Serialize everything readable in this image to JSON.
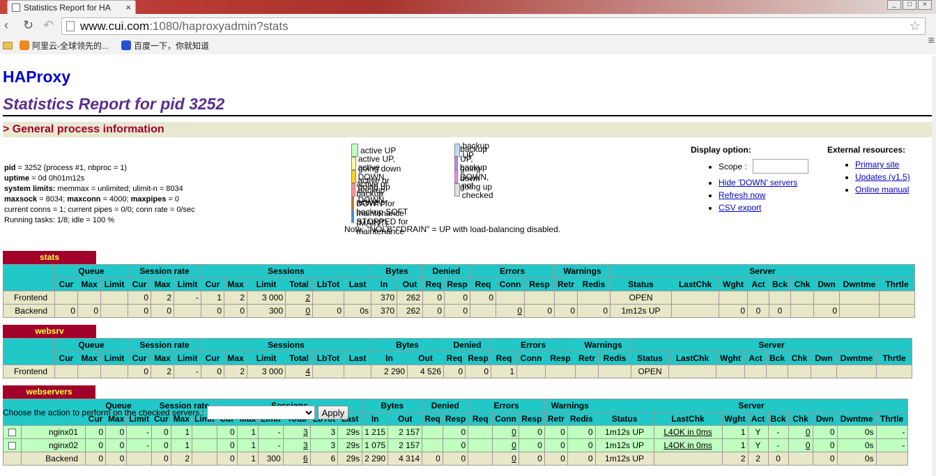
{
  "browser": {
    "tab_title": "Statistics Report for HA",
    "url_host": "www.cui.com",
    "url_rest": ":1080/haproxyadmin?stats",
    "bookmarks": [
      "阿里云-全球领先的...",
      "百度一下，你就知道"
    ]
  },
  "page": {
    "title": "HAProxy",
    "subtitle": "Statistics Report for pid 3252",
    "section": "> General process information"
  },
  "process": {
    "l1a": "pid",
    "l1b": " = 3252 (process #1, nbproc = 1)",
    "l2a": "uptime",
    "l2b": " = 0d 0h01m12s",
    "l3a": "system limits:",
    "l3b": " memmax = unlimited; ulimit-n = 8034",
    "l4a": "maxsock",
    "l4b": " = 8034; ",
    "l4c": "maxconn",
    "l4d": " = 4000; ",
    "l4e": "maxpipes",
    "l4f": " = 0",
    "l5": "current conns = 1; current pipes = 0/0; conn rate = 0/sec",
    "l6": "Running tasks: 1/8; idle = 100 %"
  },
  "legend": {
    "left": [
      {
        "label": "active UP",
        "color": "#c0ffc0"
      },
      {
        "label": "active UP, going down",
        "color": "#ffffa0"
      },
      {
        "label": "active DOWN, going up",
        "color": "#ffd020"
      },
      {
        "label": "active or backup DOWN",
        "color": "#ff9090"
      },
      {
        "label": "active or backup DOWN for maintenance (MAINT)",
        "color": "#c07820"
      },
      {
        "label": "active or backup SOFT STOPPED for maintenance",
        "color": "#3090e0"
      }
    ],
    "right": [
      {
        "label": "backup UP",
        "color": "#c0d8ff"
      },
      {
        "label": "backup UP, going down",
        "color": "#c080ff"
      },
      {
        "label": "backup DOWN, going up",
        "color": "#ff80ff"
      },
      {
        "label": "not checked",
        "color": "#e0e0e0"
      }
    ],
    "note": "Note: \"NOLB\"/\"DRAIN\" = UP with load-balancing disabled."
  },
  "display": {
    "title": "Display option:",
    "scope_label": "Scope :",
    "links": [
      "Hide 'DOWN' servers",
      "Refresh now",
      "CSV export"
    ]
  },
  "external": {
    "title": "External resources:",
    "links": [
      "Primary site",
      "Updates (v1.5)",
      "Online manual"
    ]
  },
  "headers": {
    "groups": [
      "Queue",
      "Session rate",
      "Sessions",
      "Bytes",
      "Denied",
      "Errors",
      "Warnings",
      "Server"
    ],
    "cols": [
      "Cur",
      "Max",
      "Limit",
      "Cur",
      "Max",
      "Limit",
      "Cur",
      "Max",
      "Limit",
      "Total",
      "LbTot",
      "Last",
      "In",
      "Out",
      "Req",
      "Resp",
      "Req",
      "Conn",
      "Resp",
      "Retr",
      "Redis",
      "Status",
      "LastChk",
      "Wght",
      "Act",
      "Bck",
      "Chk",
      "Dwn",
      "Dwntme",
      "Thrtle"
    ]
  },
  "proxies": [
    {
      "name": "stats",
      "checkbox": false,
      "rows": [
        {
          "cls": "fe",
          "name": "Frontend",
          "cells": [
            "",
            "",
            "",
            "0",
            "2",
            "-",
            "1",
            "2",
            "3 000",
            "2",
            "",
            "",
            "370",
            "262",
            "0",
            "0",
            "0",
            "",
            "",
            "",
            "",
            "OPEN",
            "",
            "",
            "",
            "",
            "",
            "",
            "",
            ""
          ]
        },
        {
          "cls": "be",
          "name": "Backend",
          "cells": [
            "0",
            "0",
            "",
            "0",
            "0",
            "",
            "0",
            "0",
            "300",
            "0",
            "0",
            "0s",
            "370",
            "262",
            "0",
            "0",
            "",
            "0",
            "0",
            "0",
            "0",
            "1m12s UP",
            "",
            "0",
            "0",
            "0",
            "",
            "0",
            "",
            ""
          ]
        }
      ]
    },
    {
      "name": "websrv",
      "checkbox": false,
      "rows": [
        {
          "cls": "fe",
          "name": "Frontend",
          "cells": [
            "",
            "",
            "",
            "0",
            "2",
            "-",
            "0",
            "2",
            "3 000",
            "4",
            "",
            "",
            "2 290",
            "4 526",
            "0",
            "0",
            "1",
            "",
            "",
            "",
            "",
            "OPEN",
            "",
            "",
            "",
            "",
            "",
            "",
            "",
            ""
          ]
        }
      ]
    },
    {
      "name": "webservers",
      "checkbox": true,
      "rows": [
        {
          "cls": "up",
          "name": "nginx01",
          "cells": [
            "0",
            "0",
            "-",
            "0",
            "1",
            "",
            "0",
            "1",
            "-",
            "3",
            "3",
            "29s",
            "1 215",
            "2 157",
            "",
            "0",
            "",
            "0",
            "0",
            "0",
            "0",
            "1m12s UP",
            "L4OK in 0ms",
            "1",
            "Y",
            "-",
            "0",
            "0",
            "0s",
            "-"
          ]
        },
        {
          "cls": "up",
          "name": "nginx02",
          "cells": [
            "0",
            "0",
            "-",
            "0",
            "1",
            "",
            "0",
            "1",
            "-",
            "3",
            "3",
            "29s",
            "1 075",
            "2 157",
            "",
            "0",
            "",
            "0",
            "0",
            "0",
            "0",
            "1m12s UP",
            "L4OK in 0ms",
            "1",
            "Y",
            "-",
            "0",
            "0",
            "0s",
            "-"
          ]
        },
        {
          "cls": "be",
          "name": "Backend",
          "cells": [
            "0",
            "0",
            "",
            "0",
            "2",
            "",
            "0",
            "1",
            "300",
            "6",
            "6",
            "29s",
            "2 290",
            "4 314",
            "0",
            "0",
            "",
            "0",
            "0",
            "0",
            "0",
            "1m12s UP",
            "",
            "2",
            "2",
            "0",
            "",
            "0",
            "0s",
            ""
          ]
        }
      ]
    }
  ],
  "action": {
    "label": "Choose the action to perform on the checked servers :",
    "button": "Apply"
  }
}
